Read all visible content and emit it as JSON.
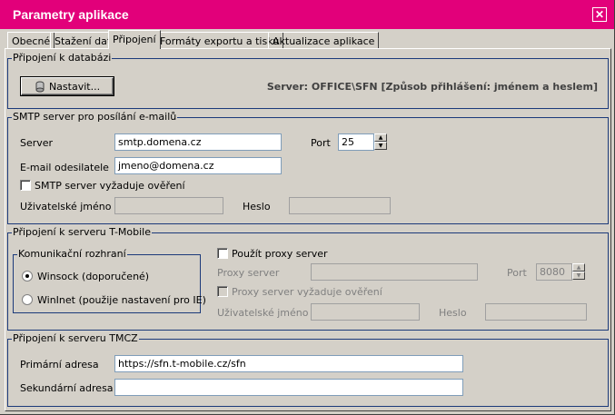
{
  "window": {
    "title": "Parametry aplikace"
  },
  "tabs": [
    "Obecné",
    "Stažení dat",
    "Připojení",
    "Formáty exportu a tisku",
    "Aktualizace aplikace"
  ],
  "db_group": {
    "title": "Připojení k databázi",
    "configure_button": "Nastavit...",
    "server_info": "Server: OFFICE\\SFN [Způsob přihlášení: jménem a heslem]"
  },
  "smtp_group": {
    "title": "SMTP server pro posílání e-mailů",
    "server_label": "Server",
    "server_value": "smtp.domena.cz",
    "port_label": "Port",
    "port_value": "25",
    "sender_label": "E-mail odesilatele",
    "sender_value": "jmeno@domena.cz",
    "auth_checkbox_label": "SMTP server vyžaduje ověření",
    "auth_checked": false,
    "username_label": "Uživatelské jméno",
    "username_value": "",
    "password_label": "Heslo",
    "password_value": ""
  },
  "tmobile_group": {
    "title": "Připojení k serveru T-Mobile",
    "interface_group_title": "Komunikační rozhraní",
    "interface_options": [
      "Winsock (doporučené)",
      "WinInet (použije nastavení pro IE)"
    ],
    "interface_selected": "Winsock (doporučené)",
    "proxy_checkbox_label": "Použít proxy server",
    "proxy_checked": false,
    "proxy_server_label": "Proxy server",
    "proxy_server_value": "",
    "proxy_port_label": "Port",
    "proxy_port_value": "8080",
    "proxy_auth_label": "Proxy server vyžaduje ověření",
    "proxy_auth_checked": false,
    "proxy_username_label": "Uživatelské jméno",
    "proxy_username_value": "",
    "proxy_password_label": "Heslo",
    "proxy_password_value": ""
  },
  "tmcz_group": {
    "title": "Připojení k serveru TMCZ",
    "primary_label": "Primární adresa",
    "primary_value": "https://sfn.t-mobile.cz/sfn",
    "secondary_label": "Sekundární adresa",
    "secondary_value": ""
  },
  "colors": {
    "titlebar": "#e2007a",
    "group_border": "#1c3a7a",
    "face": "#d4d0c8"
  }
}
